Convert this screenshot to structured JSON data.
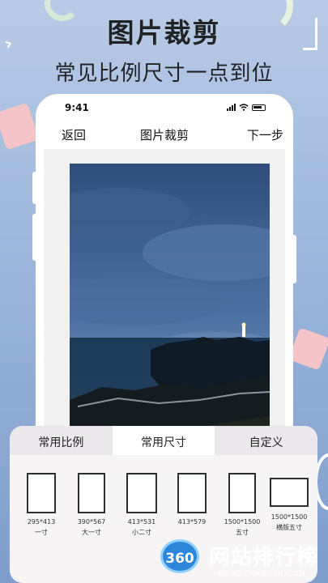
{
  "promo": {
    "title": "图片裁剪",
    "subtitle": "常见比例尺寸一点到位"
  },
  "status_bar": {
    "time": "9:41"
  },
  "nav": {
    "back": "返回",
    "title": "图片裁剪",
    "next": "下一步"
  },
  "tabs": [
    {
      "label": "常用比例",
      "active": false
    },
    {
      "label": "常用尺寸",
      "active": true
    },
    {
      "label": "自定义",
      "active": false
    }
  ],
  "sizes": [
    {
      "dims": "295*413",
      "name": "一寸"
    },
    {
      "dims": "390*567",
      "name": "大一寸"
    },
    {
      "dims": "413*531",
      "name": "小二寸"
    },
    {
      "dims": "413*579",
      "name": ""
    },
    {
      "dims": "1500*1500",
      "name": "五寸"
    },
    {
      "dims": "1500*1500",
      "name": "横版五寸"
    }
  ],
  "watermark": {
    "badge": "360",
    "text": "网站排行榜",
    "url": "-WANGZHAN360.COM"
  },
  "colors": {
    "background_top": "#b8cbe6",
    "background_bottom": "#7f9dcb",
    "accent_pink": "#f4c4c8",
    "frame_border": "#2b2f2b"
  }
}
